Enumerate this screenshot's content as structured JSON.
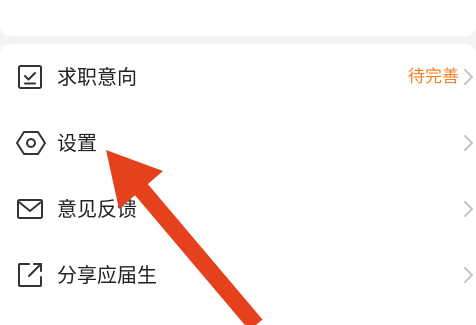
{
  "menu": {
    "items": [
      {
        "label": "求职意向",
        "status": "待完善",
        "icon": "checklist-icon"
      },
      {
        "label": "设置",
        "icon": "settings-hexagon-icon"
      },
      {
        "label": "意见反馈",
        "icon": "envelope-icon"
      },
      {
        "label": "分享应届生",
        "icon": "share-icon"
      }
    ]
  },
  "colors": {
    "status_orange": "#f2801f",
    "arrow_red": "#e5411d",
    "text": "#222222",
    "icon": "#333333",
    "chevron": "#c4c4c4"
  }
}
